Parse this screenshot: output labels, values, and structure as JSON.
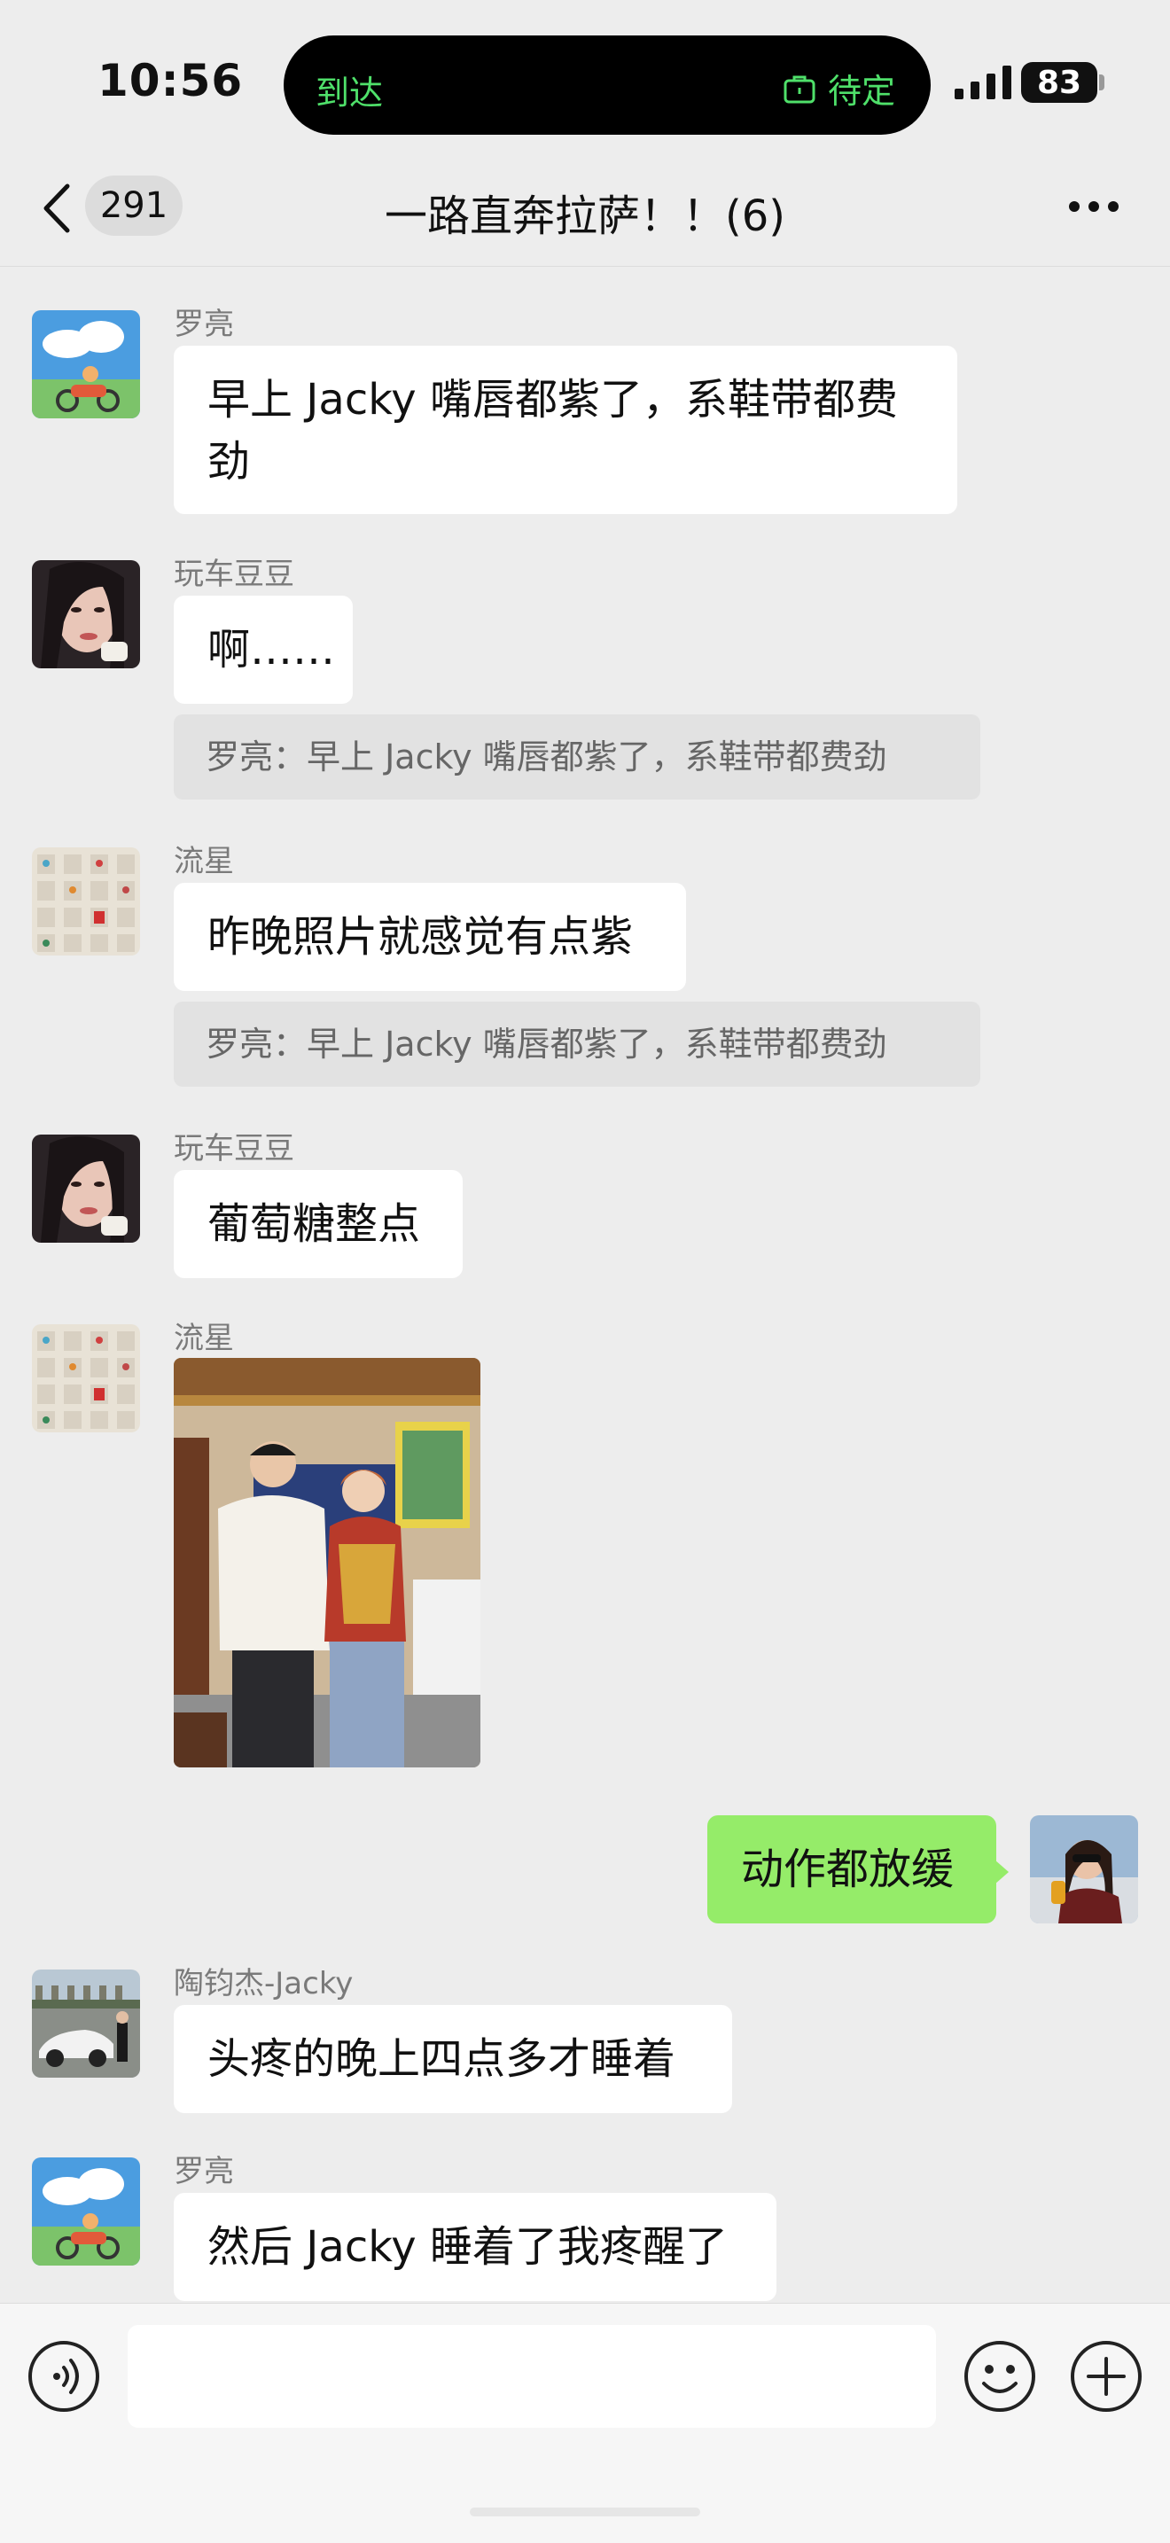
{
  "status_bar": {
    "time": "10:56",
    "island_left": "到达",
    "island_right": "待定",
    "battery": "83"
  },
  "nav": {
    "unread_count": "291",
    "title": "一路直奔拉萨！！(6)"
  },
  "messages": [
    {
      "sender": "罗亮",
      "text": "早上 Jacky 嘴唇都紫了，系鞋带都费\n劲"
    },
    {
      "sender": "玩车豆豆",
      "text": "啊……",
      "quote": "罗亮：早上 Jacky 嘴唇都紫了，系鞋带都费劲"
    },
    {
      "sender": "流星",
      "text": "昨晚照片就感觉有点紫",
      "quote": "罗亮：早上 Jacky 嘴唇都紫了，系鞋带都费劲"
    },
    {
      "sender": "玩车豆豆",
      "text": "葡萄糖整点"
    },
    {
      "sender": "流星",
      "image": "photo"
    },
    {
      "sender": "me",
      "text": "动作都放缓"
    },
    {
      "sender": "陶钧杰-Jacky",
      "text": "头疼的晚上四点多才睡着"
    },
    {
      "sender": "罗亮",
      "text": "然后 Jacky 睡着了我疼醒了"
    }
  ],
  "colors": {
    "background": "#ededed",
    "bubble_other": "#ffffff",
    "bubble_mine": "#95ec69",
    "island_text": "#4fe06a"
  },
  "icons": {
    "back": "chevron-left-icon",
    "more": "more-dots-icon",
    "voice": "voice-icon",
    "emoji": "emoji-icon",
    "plus": "plus-icon"
  }
}
